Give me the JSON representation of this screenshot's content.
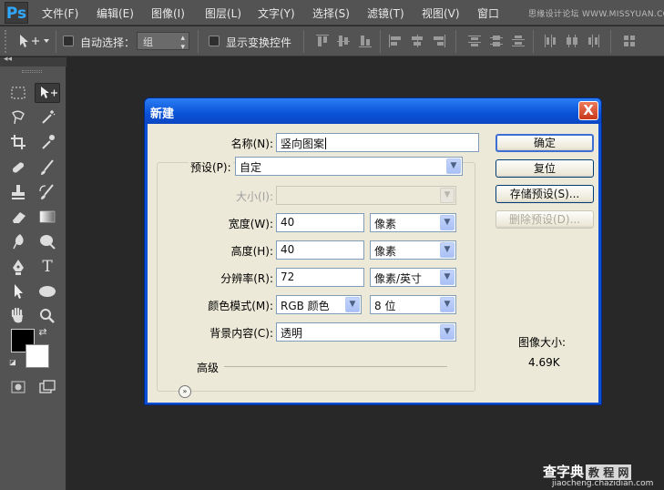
{
  "app": {
    "logo": "Ps"
  },
  "menu": [
    "文件(F)",
    "编辑(E)",
    "图像(I)",
    "图层(L)",
    "文字(Y)",
    "选择(S)",
    "滤镜(T)",
    "视图(V)",
    "窗口"
  ],
  "watermark_top": "思缘设计论坛 WWW.MISSYUAN.COM",
  "options": {
    "tool_icon": "move-tool-icon",
    "auto_select_label": "自动选择：",
    "auto_select_value": "组",
    "show_transform_label": "显示变换控件"
  },
  "toolbox": {
    "collapse": "◂◂",
    "tools": [
      "rectangular-marquee",
      "move",
      "lasso",
      "magic-wand",
      "crop",
      "eyedropper",
      "healing-brush",
      "brush",
      "clone-stamp",
      "history-brush",
      "eraser",
      "gradient",
      "blur",
      "dodge",
      "pen",
      "type",
      "path-selection",
      "ellipse",
      "hand",
      "zoom"
    ],
    "foreground_color": "#000000",
    "background_color": "#ffffff"
  },
  "dialog": {
    "title": "新建",
    "close": "X",
    "name_label": "名称(N):",
    "name_value": "竖向图案",
    "preset_label": "预设(P):",
    "preset_value": "自定",
    "size_label": "大小(I):",
    "size_value": "",
    "width_label": "宽度(W):",
    "width_value": "40",
    "width_unit": "像素",
    "height_label": "高度(H):",
    "height_value": "40",
    "height_unit": "像素",
    "resolution_label": "分辨率(R):",
    "resolution_value": "72",
    "resolution_unit": "像素/英寸",
    "color_mode_label": "颜色模式(M):",
    "color_mode_value": "RGB 颜色",
    "bit_depth_value": "8 位",
    "background_label": "背景内容(C):",
    "background_value": "透明",
    "advanced_label": "高级",
    "ok_label": "确定",
    "reset_label": "复位",
    "save_preset_label": "存储预设(S)...",
    "delete_preset_label": "删除预设(D)...",
    "image_size_label": "图像大小:",
    "image_size_value": "4.69K"
  },
  "watermark_bottom": {
    "brand": "查字典",
    "boxed": "教 程 网",
    "url": "jiaocheng.chazidian.com"
  }
}
